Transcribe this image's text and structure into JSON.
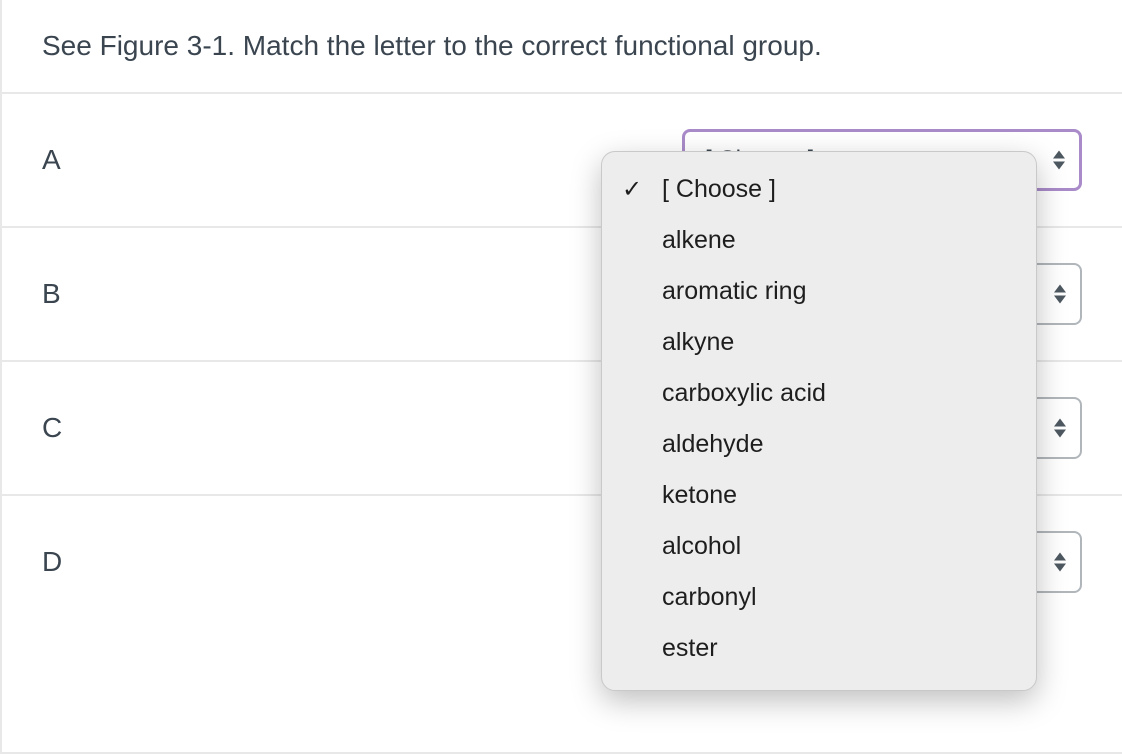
{
  "question": "See Figure 3-1.  Match the letter to the correct functional group.",
  "rows": [
    {
      "label": "A",
      "value": "[ Choose ]",
      "focused": true
    },
    {
      "label": "B",
      "value": "",
      "focused": false
    },
    {
      "label": "C",
      "value": "",
      "focused": false
    },
    {
      "label": "D",
      "value": "",
      "focused": false
    }
  ],
  "dropdown": {
    "options": [
      {
        "label": "[ Choose ]",
        "selected": true
      },
      {
        "label": "alkene",
        "selected": false
      },
      {
        "label": "aromatic ring",
        "selected": false
      },
      {
        "label": "alkyne",
        "selected": false
      },
      {
        "label": "carboxylic acid",
        "selected": false
      },
      {
        "label": "aldehyde",
        "selected": false
      },
      {
        "label": "ketone",
        "selected": false
      },
      {
        "label": "alcohol",
        "selected": false
      },
      {
        "label": "carbonyl",
        "selected": false
      },
      {
        "label": "ester",
        "selected": false
      }
    ]
  }
}
